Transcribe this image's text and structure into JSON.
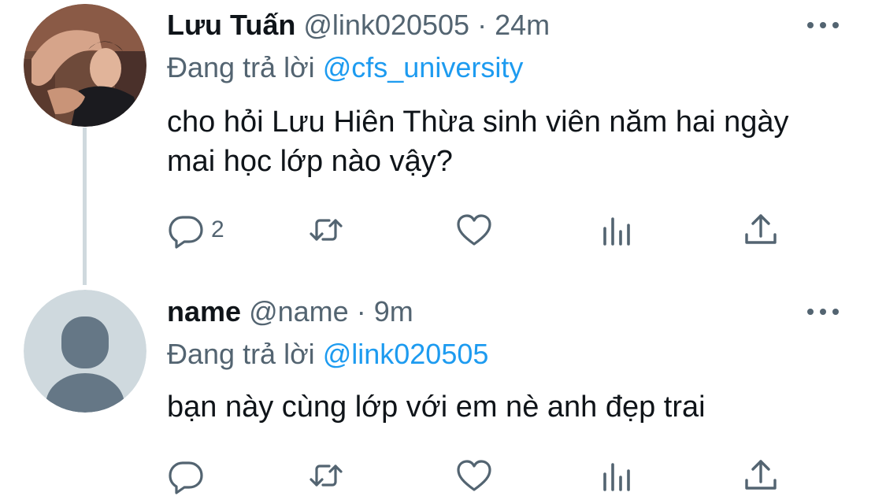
{
  "tweets": [
    {
      "display_name": "Lưu Tuấn",
      "handle": "@link020505",
      "separator": "·",
      "time": "24m",
      "replying_prefix": "Đang trả lời",
      "replying_to": "@cfs_university",
      "text": " cho hỏi Lưu Hiên Thừa sinh viên năm hai ngày mai học lớp nào vậy?",
      "reply_count": "2",
      "avatar": "photo"
    },
    {
      "display_name": "name",
      "handle": "@name",
      "separator": "·",
      "time": "9m",
      "replying_prefix": "Đang trả lời",
      "replying_to": "@link020505",
      "text": "bạn này cùng lớp với em nè anh đẹp trai",
      "reply_count": "",
      "avatar": "default"
    }
  ],
  "icons": {
    "reply": "reply-icon",
    "retweet": "retweet-icon",
    "like": "heart-icon",
    "analytics": "analytics-icon",
    "share": "share-icon",
    "more": "more-icon"
  },
  "colors": {
    "link": "#1d9bf0",
    "secondary_text": "#536471",
    "primary_text": "#0f1419",
    "thread_line": "#cfd9de",
    "default_avatar_bg": "#cfd9de",
    "default_avatar_fg": "#657786"
  }
}
